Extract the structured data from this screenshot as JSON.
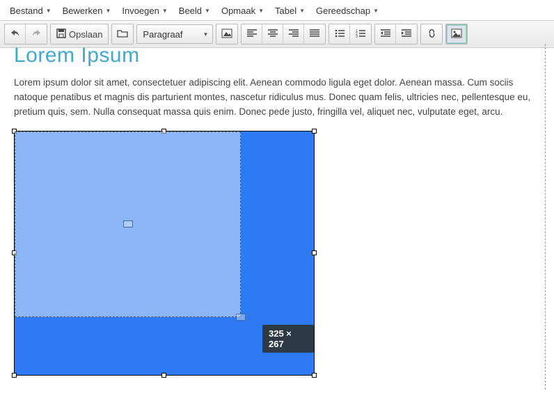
{
  "menus": {
    "file": "Bestand",
    "edit": "Bewerken",
    "insert": "Invoegen",
    "view": "Beeld",
    "format": "Opmaak",
    "table": "Tabel",
    "tools": "Gereedschap"
  },
  "toolbar": {
    "save_label": "Opslaan",
    "format_selected": "Paragraaf"
  },
  "content": {
    "heading": "Lorem Ipsum",
    "body": "Lorem ipsum dolor sit amet, consectetuer adipiscing elit. Aenean commodo ligula eget dolor. Aenean massa. Cum sociis natoque penatibus et magnis dis parturient montes, nascetur ridiculus mus. Donec quam felis, ultricies nec, pellentesque eu, pretium quis, sem. Nulla consequat massa quis enim. Donec pede justo, fringilla vel, aliquet nec, vulputate eget, arcu."
  },
  "resize": {
    "tooltip": "325 × 267"
  }
}
